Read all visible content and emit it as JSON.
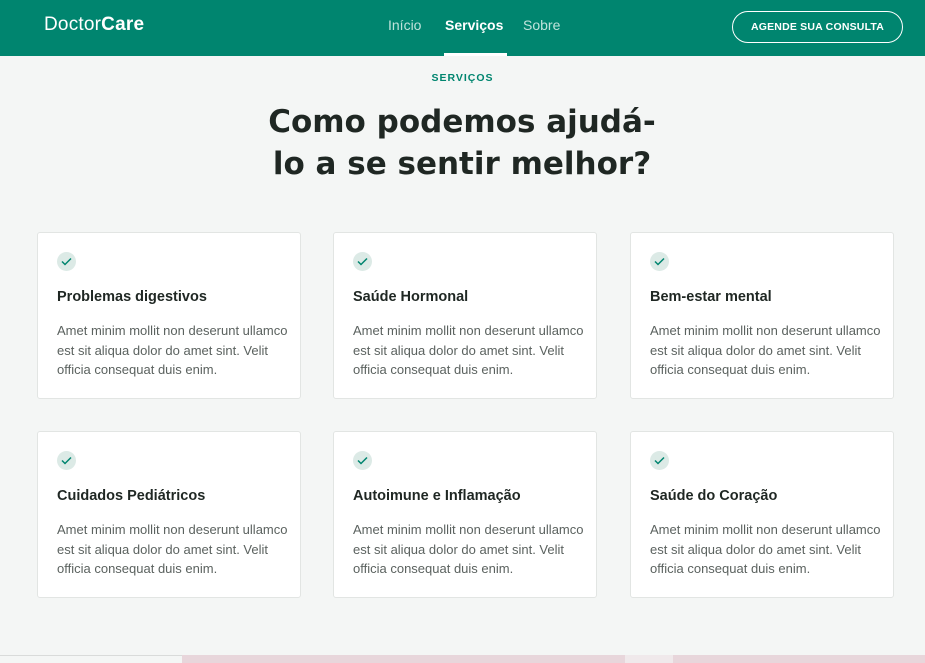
{
  "header": {
    "logo_regular": "Doctor",
    "logo_bold": "Care",
    "nav": [
      "Início",
      "Serviços",
      "Sobre"
    ],
    "active_nav": "Serviços",
    "cta_label": "AGENDE SUA CONSULTA"
  },
  "services": {
    "eyebrow": "SERVIÇOS",
    "heading_line1": "Como podemos ajudá-",
    "heading_line2": "lo a se sentir melhor?",
    "cards": [
      {
        "title": "Problemas digestivos",
        "text": "Amet minim mollit non deserunt ullamco est sit aliqua dolor do amet sint. Velit officia consequat duis enim."
      },
      {
        "title": "Saúde Hormonal",
        "text": "Amet minim mollit non deserunt ullamco est sit aliqua dolor do amet sint. Velit officia consequat duis enim."
      },
      {
        "title": "Bem-estar mental",
        "text": "Amet minim mollit non deserunt ullamco est sit aliqua dolor do amet sint. Velit officia consequat duis enim."
      },
      {
        "title": "Cuidados Pediátricos",
        "text": "Amet minim mollit non deserunt ullamco est sit aliqua dolor do amet sint. Velit officia consequat duis enim."
      },
      {
        "title": "Autoimune e Inflamação",
        "text": "Amet minim mollit non deserunt ullamco est sit aliqua dolor do amet sint. Velit officia consequat duis enim."
      },
      {
        "title": "Saúde do Coração",
        "text": "Amet minim mollit non deserunt ullamco est sit aliqua dolor do amet sint. Velit officia consequat duis enim."
      }
    ]
  },
  "icons": {
    "card_icon": "check-icon"
  },
  "colors": {
    "brand": "#00856F",
    "background": "#F4F6F5",
    "check_bg": "#DCEAE6"
  }
}
